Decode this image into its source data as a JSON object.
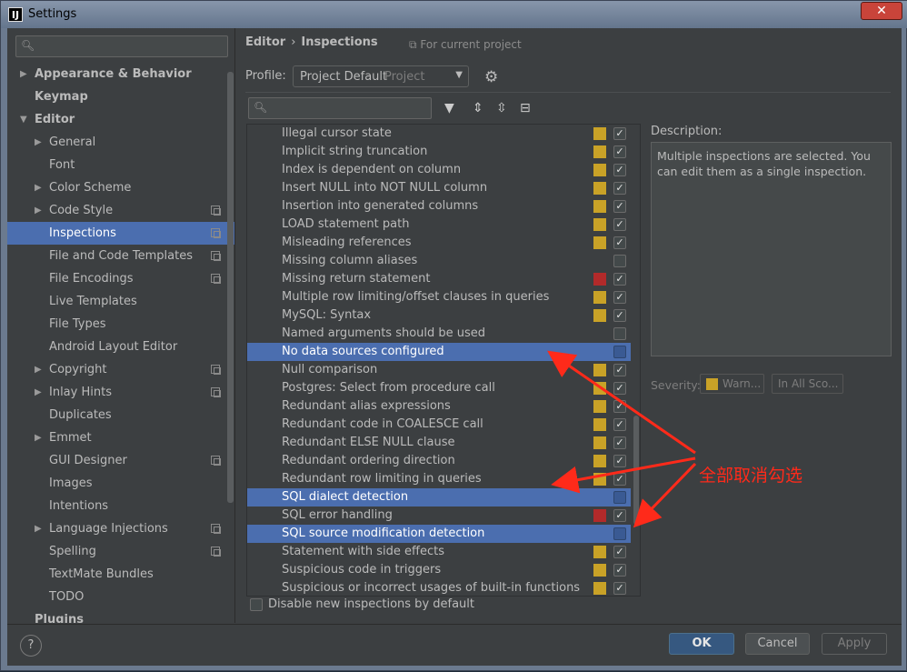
{
  "window": {
    "title": "Settings",
    "app_icon_text": "IJ",
    "close_glyph": "✕"
  },
  "search": {
    "placeholder": "Q"
  },
  "sidebar": {
    "items": [
      {
        "label": "Appearance & Behavior",
        "bold": true,
        "arrow": "▶",
        "level": 0
      },
      {
        "label": "Keymap",
        "bold": true,
        "arrow": "",
        "level": 0
      },
      {
        "label": "Editor",
        "bold": true,
        "arrow": "▼",
        "level": 0
      },
      {
        "label": "General",
        "arrow": "▶",
        "level": 1
      },
      {
        "label": "Font",
        "arrow": "",
        "level": 1
      },
      {
        "label": "Color Scheme",
        "arrow": "▶",
        "level": 1
      },
      {
        "label": "Code Style",
        "arrow": "▶",
        "level": 1,
        "copy": true
      },
      {
        "label": "Inspections",
        "arrow": "",
        "level": 1,
        "copy": true,
        "selected": true
      },
      {
        "label": "File and Code Templates",
        "arrow": "",
        "level": 1,
        "copy": true
      },
      {
        "label": "File Encodings",
        "arrow": "",
        "level": 1,
        "copy": true
      },
      {
        "label": "Live Templates",
        "arrow": "",
        "level": 1
      },
      {
        "label": "File Types",
        "arrow": "",
        "level": 1
      },
      {
        "label": "Android Layout Editor",
        "arrow": "",
        "level": 1
      },
      {
        "label": "Copyright",
        "arrow": "▶",
        "level": 1,
        "copy": true
      },
      {
        "label": "Inlay Hints",
        "arrow": "▶",
        "level": 1,
        "copy": true
      },
      {
        "label": "Duplicates",
        "arrow": "",
        "level": 1
      },
      {
        "label": "Emmet",
        "arrow": "▶",
        "level": 1
      },
      {
        "label": "GUI Designer",
        "arrow": "",
        "level": 1,
        "copy": true
      },
      {
        "label": "Images",
        "arrow": "",
        "level": 1
      },
      {
        "label": "Intentions",
        "arrow": "",
        "level": 1
      },
      {
        "label": "Language Injections",
        "arrow": "▶",
        "level": 1,
        "copy": true
      },
      {
        "label": "Spelling",
        "arrow": "",
        "level": 1,
        "copy": true
      },
      {
        "label": "TextMate Bundles",
        "arrow": "",
        "level": 1
      },
      {
        "label": "TODO",
        "arrow": "",
        "level": 1
      },
      {
        "label": "Plugins",
        "bold": true,
        "arrow": "",
        "level": 0
      }
    ]
  },
  "breadcrumb": {
    "section": "Editor",
    "separator": "›",
    "page": "Inspections",
    "for_project": "For current project"
  },
  "profile": {
    "label": "Profile:",
    "name": "Project Default",
    "scope": "Project"
  },
  "inspections": [
    {
      "label": "Illegal cursor state",
      "severity": "#c9a227",
      "checked": true
    },
    {
      "label": "Implicit string truncation",
      "severity": "#c9a227",
      "checked": true
    },
    {
      "label": "Index is dependent on column",
      "severity": "#c9a227",
      "checked": true
    },
    {
      "label": "Insert NULL into NOT NULL column",
      "severity": "#c9a227",
      "checked": true
    },
    {
      "label": "Insertion into generated columns",
      "severity": "#c9a227",
      "checked": true
    },
    {
      "label": "LOAD statement path",
      "severity": "#c9a227",
      "checked": true
    },
    {
      "label": "Misleading references",
      "severity": "#c9a227",
      "checked": true
    },
    {
      "label": "Missing column aliases",
      "severity": "",
      "checked": false
    },
    {
      "label": "Missing return statement",
      "severity": "#b22a2a",
      "checked": true
    },
    {
      "label": "Multiple row limiting/offset clauses in queries",
      "severity": "#c9a227",
      "checked": true
    },
    {
      "label": "MySQL: Syntax",
      "severity": "#c9a227",
      "checked": true
    },
    {
      "label": "Named arguments should be used",
      "severity": "",
      "checked": false
    },
    {
      "label": "No data sources configured",
      "severity": "",
      "checked": false,
      "selected": true
    },
    {
      "label": "Null comparison",
      "severity": "#c9a227",
      "checked": true
    },
    {
      "label": "Postgres: Select from procedure call",
      "severity": "#c9a227",
      "checked": true
    },
    {
      "label": "Redundant alias expressions",
      "severity": "#c9a227",
      "checked": true
    },
    {
      "label": "Redundant code in COALESCE call",
      "severity": "#c9a227",
      "checked": true
    },
    {
      "label": "Redundant ELSE NULL clause",
      "severity": "#c9a227",
      "checked": true
    },
    {
      "label": "Redundant ordering direction",
      "severity": "#c9a227",
      "checked": true
    },
    {
      "label": "Redundant row limiting in queries",
      "severity": "#c9a227",
      "checked": true
    },
    {
      "label": "SQL dialect detection",
      "severity": "",
      "checked": false,
      "selected": true
    },
    {
      "label": "SQL error handling",
      "severity": "#b22a2a",
      "checked": true
    },
    {
      "label": "SQL source modification detection",
      "severity": "",
      "checked": false,
      "selected": true
    },
    {
      "label": "Statement with side effects",
      "severity": "#c9a227",
      "checked": true
    },
    {
      "label": "Suspicious code in triggers",
      "severity": "#c9a227",
      "checked": true
    },
    {
      "label": "Suspicious or incorrect usages of built-in functions",
      "severity": "#c9a227",
      "checked": true
    }
  ],
  "disable_new": {
    "label": "Disable new inspections by default",
    "checked": false
  },
  "description": {
    "label": "Description:",
    "text": "Multiple inspections are selected. You can edit them as a single inspection."
  },
  "severity": {
    "label": "Severity:",
    "value": "Warn...",
    "scope": "In All Sco..."
  },
  "annotation": {
    "text": "全部取消勾选",
    "color": "#ff2a1a"
  },
  "footer": {
    "help": "?",
    "ok": "OK",
    "cancel": "Cancel",
    "apply": "Apply"
  },
  "colors": {
    "selection": "#4b6eaf",
    "background": "#3c3f41",
    "warning": "#c9a227",
    "error": "#b22a2a"
  }
}
